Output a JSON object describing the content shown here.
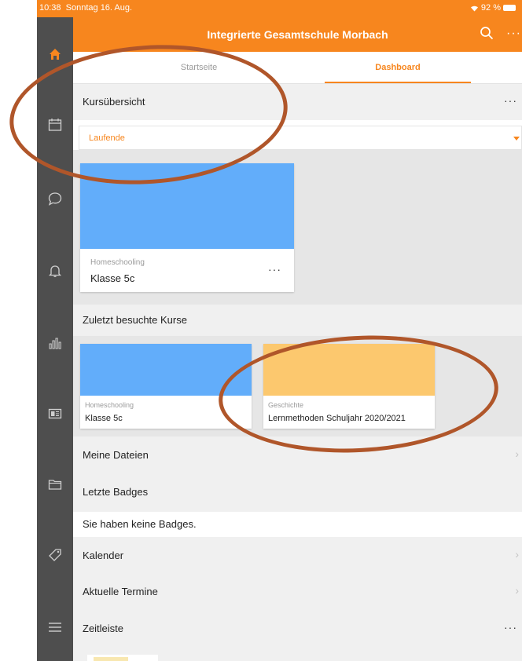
{
  "status_bar": {
    "time": "10:38",
    "date": "Sonntag 16. Aug.",
    "battery": "92 %"
  },
  "app": {
    "title": "Integrierte Gesamtschule Morbach",
    "more_label": "···"
  },
  "tabs": [
    {
      "label": "Startseite"
    },
    {
      "label": "Dashboard"
    }
  ],
  "colors": {
    "accent": "#f7861e",
    "sidebar": "#4e4e4e",
    "annotation": "#b0562a"
  },
  "sidebar": {
    "icons": [
      "home-icon",
      "calendar-icon",
      "chat-icon",
      "bell-icon",
      "chart-icon",
      "news-icon",
      "folder-icon",
      "tag-icon",
      "menu-icon"
    ]
  },
  "course_overview": {
    "title": "Kursübersicht",
    "more_label": "···",
    "filter_value": "Laufende",
    "card": {
      "category": "Homeschooling",
      "name": "Klasse 5c",
      "more_label": "···",
      "color": "#62adfa"
    }
  },
  "recent_courses": {
    "title": "Zuletzt besuchte Kurse",
    "cards": [
      {
        "category": "Homeschooling",
        "name": "Klasse 5c",
        "color": "#62adfa"
      },
      {
        "category": "Geschichte",
        "name": "Lernmethoden Schuljahr 2020/2021",
        "color": "#fcc86e"
      }
    ]
  },
  "sections": {
    "my_files": "Meine Dateien",
    "badges": "Letzte Badges",
    "no_badges": "Sie haben keine Badges.",
    "calendar": "Kalender",
    "events": "Aktuelle Termine",
    "timeline": "Zeitleiste",
    "timeline_more": "···",
    "chevron": "›"
  }
}
